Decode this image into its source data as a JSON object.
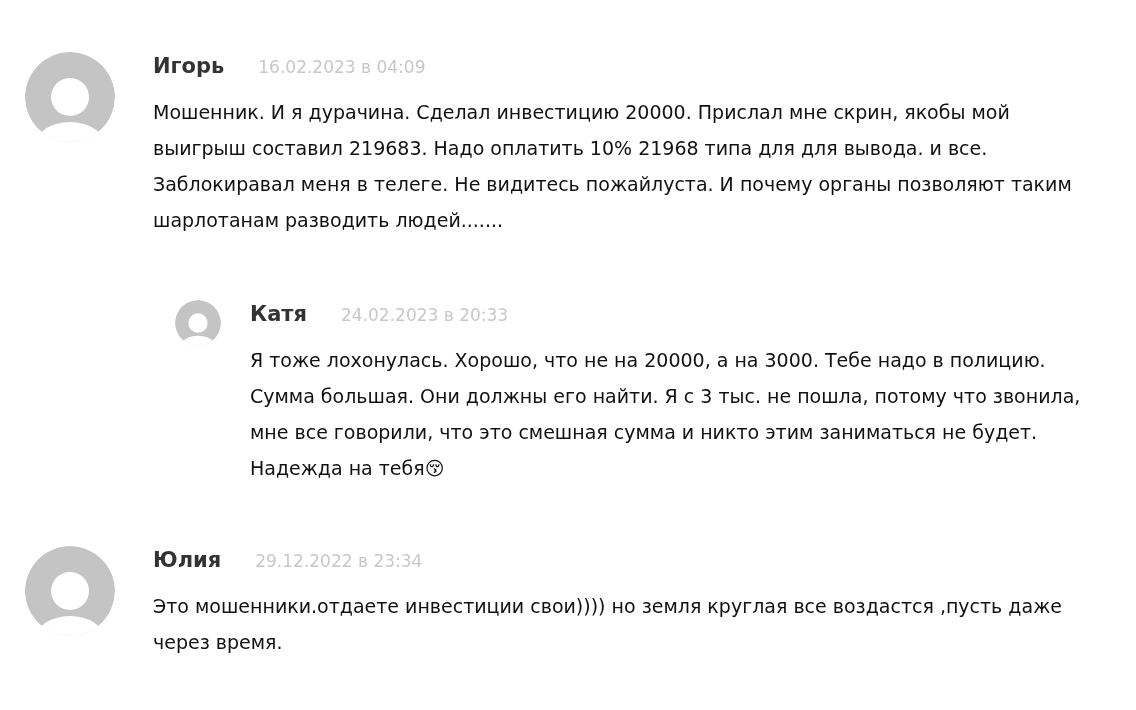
{
  "comments": [
    {
      "author": "Игорь",
      "date": "16.02.2023 в 04:09",
      "text": "Мошенник. И я дурачина. Сделал инвестицию 20000. Прислал мне скрин, якобы мой выигрыш составил 219683. Надо оплатить 10% 21968 типа для для вывода. и все. Заблокиравал меня в телеге. Не видитесь пожайлуста. И почему органы позволяют таким шарлотанам разводить людей.......",
      "children": [
        {
          "author": "Катя",
          "date": "24.02.2023 в 20:33",
          "text": "Я тоже лохонулась. Хорошо, что не на 20000, а на 3000. Тебе надо в полицию. Сумма большая. Они должны его найти. Я с 3 тыс. не пошла, потому что звонила, мне все говорили, что это смешная сумма и никто этим заниматься не будет. Надежда на тебя😚"
        }
      ]
    },
    {
      "author": "Юлия",
      "date": "29.12.2022 в 23:34",
      "text": "Это мошенники.отдаете инвестиции свои)))) но земля круглая все воздастся ,пусть даже через время."
    }
  ]
}
